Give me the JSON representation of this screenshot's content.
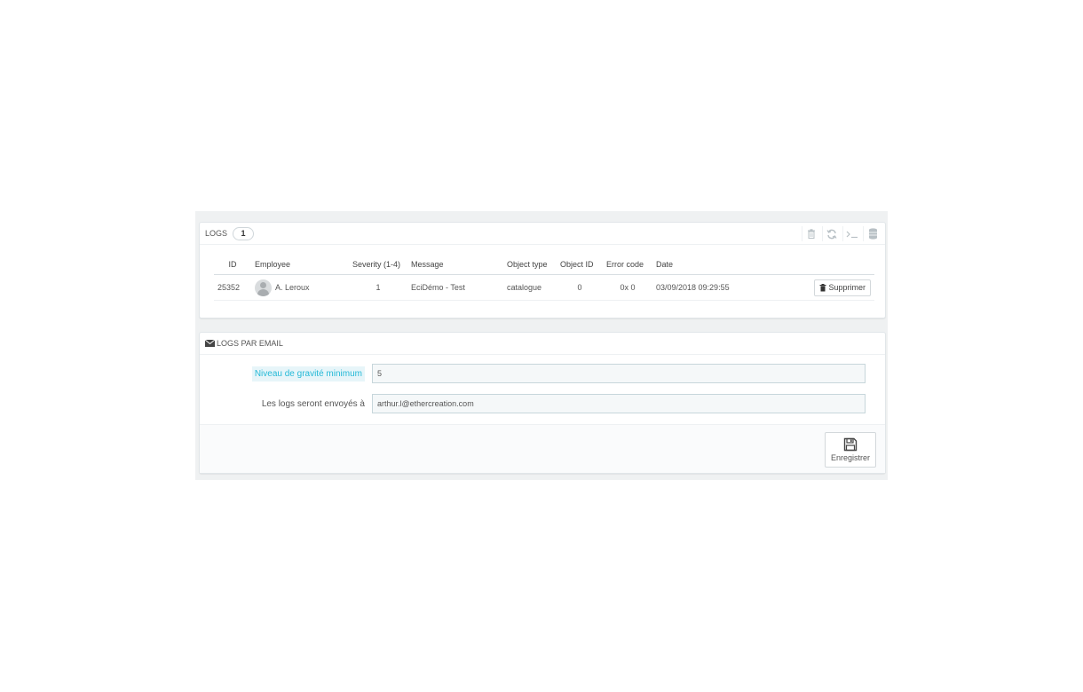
{
  "logs_panel": {
    "title": "LOGS",
    "count": "1",
    "toolbar_icons": [
      "trash-icon",
      "refresh-icon",
      "terminal-icon",
      "database-icon"
    ],
    "columns": [
      "ID",
      "Employee",
      "Severity (1-4)",
      "Message",
      "Object type",
      "Object ID",
      "Error code",
      "Date"
    ],
    "rows": [
      {
        "id": "25352",
        "employee": "A. Leroux",
        "severity": "1",
        "message": "EciDémo - Test",
        "object_type": "catalogue",
        "object_id": "0",
        "error_code": "0x 0",
        "date": "03/09/2018 09:29:55",
        "action": "Supprimer"
      }
    ]
  },
  "email_panel": {
    "title": "LOGS PAR EMAIL",
    "severity_label": "Niveau de gravité minimum",
    "severity_value": "5",
    "email_label": "Les logs seront envoyés à",
    "email_value": "arthur.l@ethercreation.com",
    "save_label": "Enregistrer"
  },
  "colors": {
    "accent": "#25b9d7",
    "background": "#eff1f2"
  }
}
